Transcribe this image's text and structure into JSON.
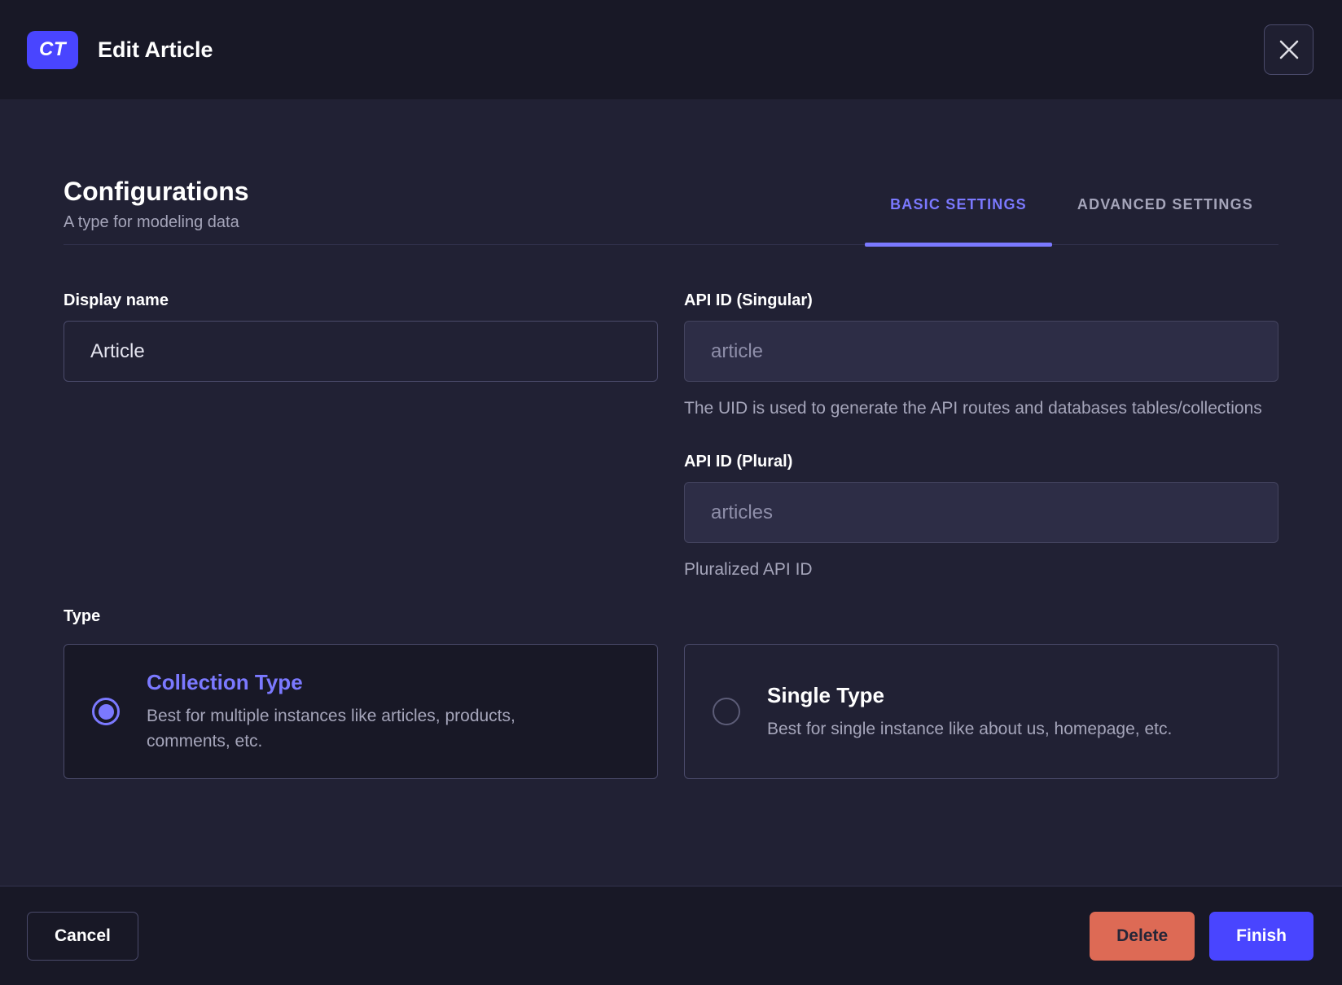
{
  "colors": {
    "primary": "#4945ff",
    "primary_light": "#7b79ff",
    "danger": "#dd6a55",
    "header_bg": "#181826",
    "body_bg": "#212134"
  },
  "header": {
    "badge": "CT",
    "title": "Edit Article",
    "close_icon": "close-icon"
  },
  "main": {
    "title": "Configurations",
    "subtitle": "A type for modeling data",
    "tabs": [
      {
        "label": "BASIC SETTINGS",
        "active": true
      },
      {
        "label": "ADVANCED SETTINGS",
        "active": false
      }
    ],
    "fields": {
      "display_name": {
        "label": "Display name",
        "value": "Article"
      },
      "api_id_singular": {
        "label": "API ID (Singular)",
        "value": "article",
        "helper": "The UID is used to generate the API routes and databases tables/collections"
      },
      "api_id_plural": {
        "label": "API ID (Plural)",
        "value": "articles",
        "helper": "Pluralized API ID"
      }
    },
    "type_section": {
      "label": "Type",
      "options": [
        {
          "title": "Collection Type",
          "description": "Best for multiple instances like articles, products, comments, etc.",
          "selected": true
        },
        {
          "title": "Single Type",
          "description": "Best for single instance like about us, homepage, etc.",
          "selected": false
        }
      ]
    }
  },
  "footer": {
    "cancel_label": "Cancel",
    "delete_label": "Delete",
    "finish_label": "Finish"
  }
}
